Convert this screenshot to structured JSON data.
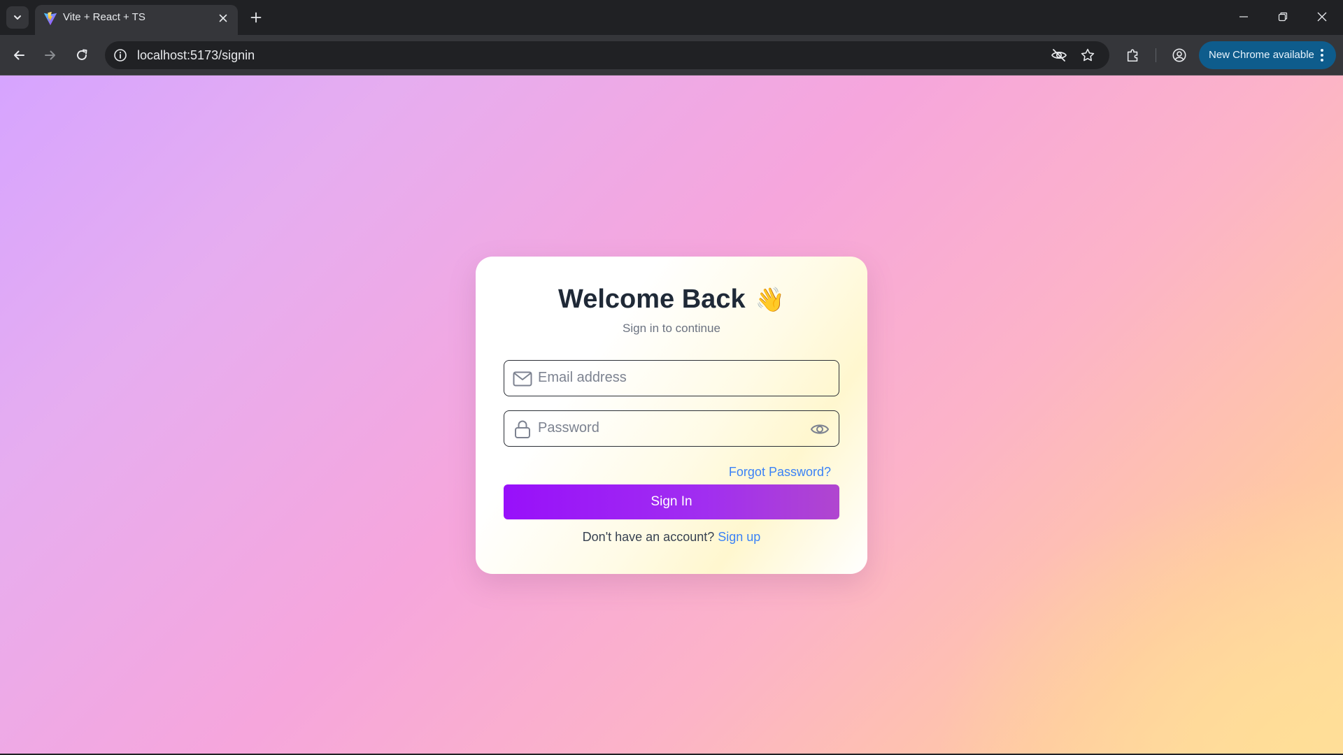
{
  "browser": {
    "tab": {
      "title": "Vite + React + TS",
      "favicon": "vite-logo"
    },
    "address_bar": {
      "url": "localhost:5173/signin"
    },
    "update_chip": {
      "label": "New Chrome available"
    },
    "icons": [
      "chevron-down-icon",
      "close-icon",
      "plus-icon",
      "minimize-icon",
      "restore-icon",
      "back-arrow-icon",
      "forward-arrow-icon",
      "reload-icon",
      "info-icon",
      "eye-off-icon",
      "star-icon",
      "extensions-icon",
      "profile-icon",
      "kebab-menu-icon"
    ]
  },
  "page": {
    "title": "Welcome Back",
    "title_emoji": "👋",
    "subtitle": "Sign in to continue",
    "email": {
      "placeholder": "Email address",
      "value": "",
      "icon": "mail-icon"
    },
    "password": {
      "placeholder": "Password",
      "value": "",
      "icon": "lock-icon",
      "toggle_icon": "eye-icon"
    },
    "forgot_password": "Forgot Password?",
    "submit": "Sign In",
    "signup_prompt": "Don't have an account?",
    "signup_link": "Sign up"
  },
  "colors": {
    "accent": "#9810fa",
    "link": "#3b82f6",
    "title": "#1f2937",
    "browser_dark": "#202124",
    "browser_toolbar": "#35363a",
    "update_chip": "#0e5c8c"
  }
}
